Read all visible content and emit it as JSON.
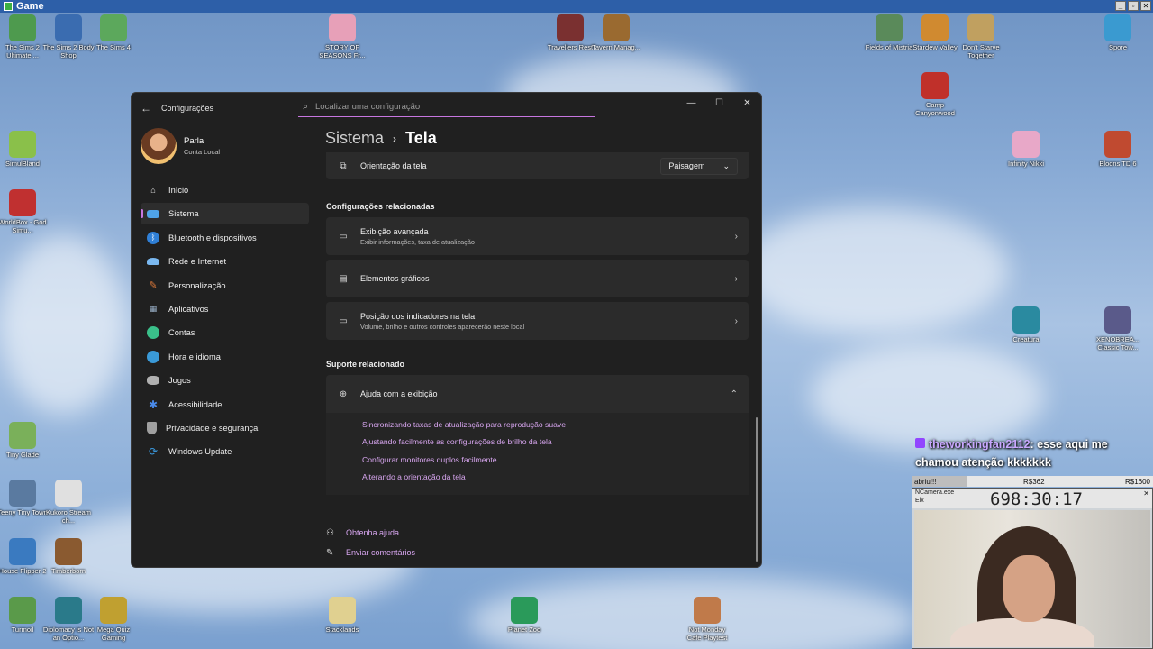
{
  "outer_window": {
    "title": "Game"
  },
  "desktop_icons": [
    {
      "label": "The Sims 2 Ultimate ...",
      "color": "#4e9a4e"
    },
    {
      "label": "The Sims 2 Body Shop",
      "color": "#3a6cb0"
    },
    {
      "label": "The Sims 4",
      "color": "#5ca85c"
    },
    {
      "label": "STORY OF SEASONS Fr...",
      "color": "#e7a0b8"
    },
    {
      "label": "Travellers Rest",
      "color": "#7a3030"
    },
    {
      "label": "Tavern Manag...",
      "color": "#9a6a30"
    },
    {
      "label": "Fields of Mistria",
      "color": "#5a8a5a"
    },
    {
      "label": "Stardew Valley",
      "color": "#d08a30"
    },
    {
      "label": "Don't Starve Together",
      "color": "#c0a060"
    },
    {
      "label": "Spore",
      "color": "#3a9ad0"
    },
    {
      "label": "Camp Canyonwood",
      "color": "#c0302a"
    },
    {
      "label": "SimulBland",
      "color": "#8ac04a"
    },
    {
      "label": "WorldBox - God Simu...",
      "color": "#c03030"
    },
    {
      "label": "Infinity Nikki",
      "color": "#e8a8c8"
    },
    {
      "label": "Bloons TD 6",
      "color": "#c04a30"
    },
    {
      "label": "Creatura",
      "color": "#2a8aa0"
    },
    {
      "label": "XENOBREA... Classic Tow...",
      "color": "#5a5a8a"
    },
    {
      "label": "Tiny Glade",
      "color": "#7ab05a"
    },
    {
      "label": "Teeny Tiny Town",
      "color": "#5a7aa0"
    },
    {
      "label": "Kukoro Stream ch...",
      "color": "#e0e0e0"
    },
    {
      "label": "House Flipper 2",
      "color": "#3a7ac0"
    },
    {
      "label": "Timberborn",
      "color": "#8a5a30"
    },
    {
      "label": "Turmoil",
      "color": "#5a9a4a"
    },
    {
      "label": "Diplomacy is Not an Optio...",
      "color": "#2a7a8a"
    },
    {
      "label": "Mega Quiz Gaming",
      "color": "#c0a030"
    },
    {
      "label": "Stacklands",
      "color": "#e0d090"
    },
    {
      "label": "Planet Zoo",
      "color": "#2a9a5a"
    },
    {
      "label": "Not Monday Cafe Playtest",
      "color": "#c07a4a"
    }
  ],
  "settings": {
    "app_title": "Configurações",
    "search_placeholder": "Localizar uma configuração",
    "profile": {
      "name": "Parla",
      "account": "Conta Local"
    },
    "nav": [
      {
        "label": "Início",
        "icon": "home-icon",
        "color": "#e8e8e8"
      },
      {
        "label": "Sistema",
        "icon": "system-icon",
        "color": "#4fa3e8"
      },
      {
        "label": "Bluetooth e dispositivos",
        "icon": "bluetooth-icon",
        "color": "#2f7fd6"
      },
      {
        "label": "Rede e Internet",
        "icon": "network-icon",
        "color": "#7ab8f0"
      },
      {
        "label": "Personalização",
        "icon": "brush-icon",
        "color": "#e07a3a"
      },
      {
        "label": "Aplicativos",
        "icon": "apps-icon",
        "color": "#9ab0c8"
      },
      {
        "label": "Contas",
        "icon": "person-icon",
        "color": "#3ac08a"
      },
      {
        "label": "Hora e idioma",
        "icon": "globe-clock-icon",
        "color": "#3a9ad8"
      },
      {
        "label": "Jogos",
        "icon": "gamepad-icon",
        "color": "#b0b0b0"
      },
      {
        "label": "Acessibilidade",
        "icon": "accessibility-icon",
        "color": "#4a8ae8"
      },
      {
        "label": "Privacidade e segurança",
        "icon": "shield-icon",
        "color": "#a0a0a0"
      },
      {
        "label": "Windows Update",
        "icon": "update-icon",
        "color": "#3a9ae0"
      }
    ],
    "breadcrumb": {
      "parent": "Sistema",
      "current": "Tela"
    },
    "orientation": {
      "label": "Orientação da tela",
      "value": "Paisagem"
    },
    "related_heading": "Configurações relacionadas",
    "related": [
      {
        "title": "Exibição avançada",
        "subtitle": "Exibir informações, taxa de atualização"
      },
      {
        "title": "Elementos gráficos",
        "subtitle": ""
      },
      {
        "title": "Posição dos indicadores na tela",
        "subtitle": "Volume, brilho e outros controles aparecerão neste local"
      }
    ],
    "support_heading": "Suporte relacionado",
    "help": {
      "title": "Ajuda com a exibição",
      "links": [
        "Sincronizando taxas de atualização para reprodução suave",
        "Ajustando facilmente as configurações de brilho da tela",
        "Configurar monitores duplos facilmente",
        "Alterando a orientação da tela"
      ]
    },
    "footer": {
      "get_help": "Obtenha ajuda",
      "feedback": "Enviar comentários"
    }
  },
  "stream": {
    "chat_user": "theworkingfan2112",
    "chat_message": ": esse aqui me chamou atenção kkkkkkk",
    "goal_label": "abriu!!!",
    "goal_mid": "R$362",
    "goal_target": "R$1600",
    "goal_fill": 0.23,
    "cam_title": "NCamera.exe",
    "cam_sub": "Eix",
    "timer": "698:30:17"
  }
}
